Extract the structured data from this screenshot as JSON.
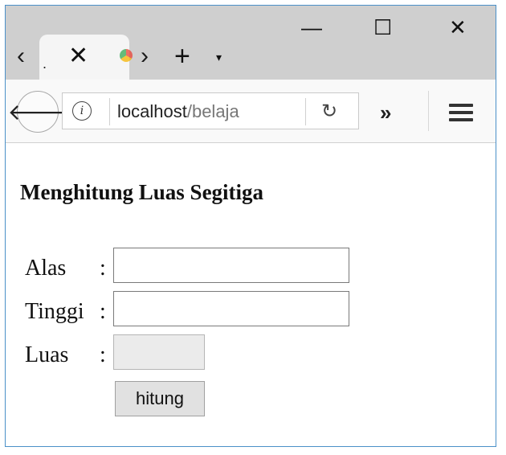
{
  "browser": {
    "tab": {
      "title_fragment": ".",
      "close_glyph": "✕"
    },
    "tab_scroll_left_glyph": "‹",
    "tab_scroll_right_glyph": "›",
    "new_tab_glyph": "+",
    "tab_list_glyph": "▾",
    "window_controls": {
      "minimize": "—",
      "maximize": "☐",
      "close": "✕"
    },
    "back_glyph": "🡐",
    "address": {
      "host": "localhost",
      "path": "/belaja"
    },
    "info_glyph": "i",
    "reload_glyph": "↻",
    "overflow_glyph": "»"
  },
  "page": {
    "heading": "Menghitung Luas Segitiga",
    "form": {
      "alas_label": "Alas",
      "tinggi_label": "Tinggi",
      "luas_label": "Luas",
      "colon": ":",
      "alas_value": "",
      "tinggi_value": "",
      "luas_value": "",
      "submit_label": "hitung"
    }
  }
}
